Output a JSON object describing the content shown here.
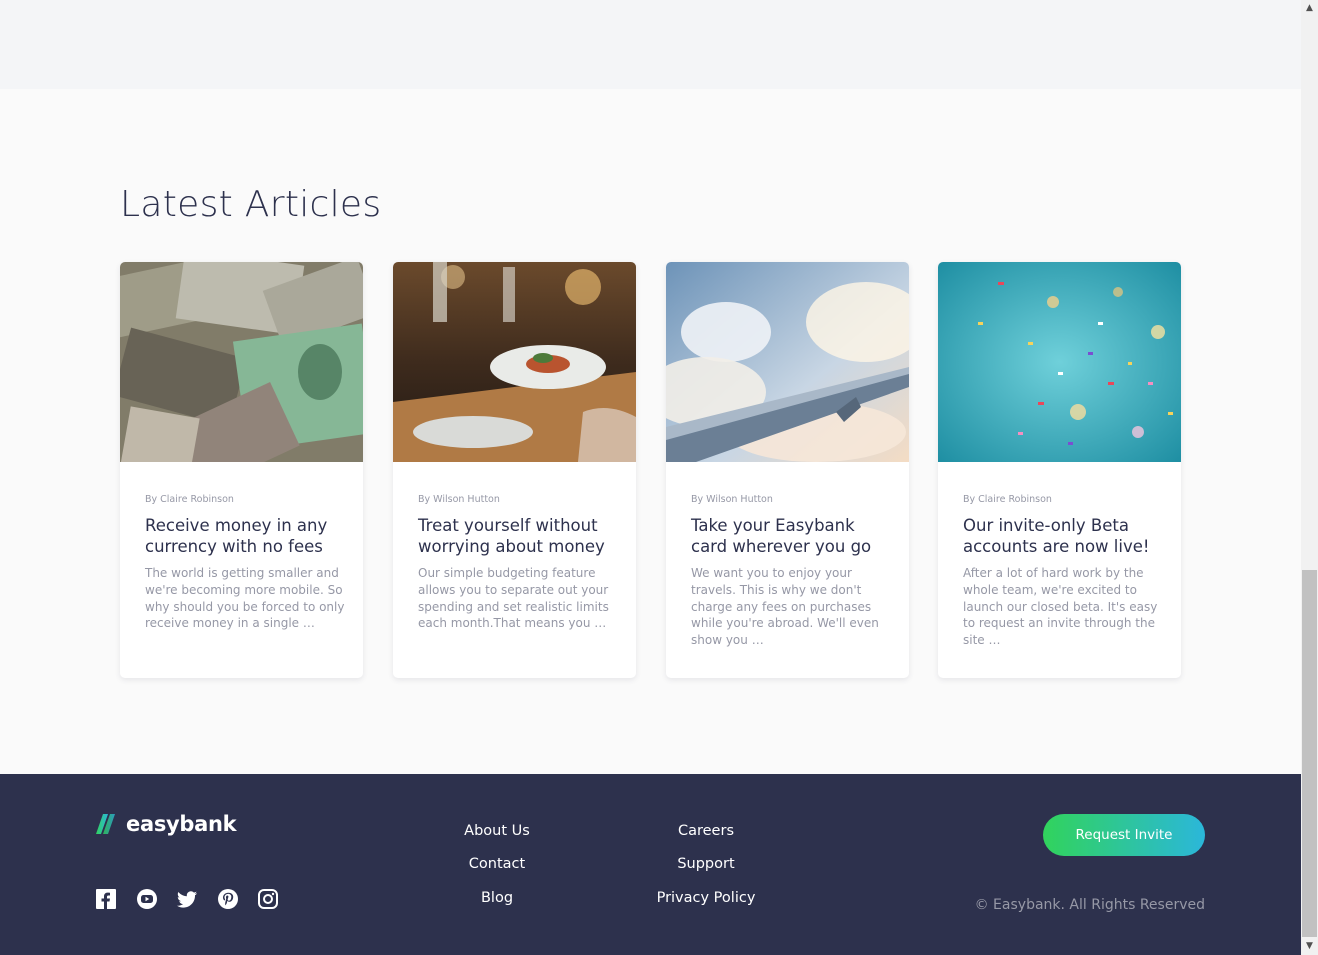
{
  "articles_section": {
    "title": "Latest Articles",
    "cards": [
      {
        "author": "By Claire Robinson",
        "title": "Receive money in any currency with no fees",
        "excerpt": "The world is getting smaller and we're becoming more mobile. So why should you be forced to only receive money in a single …"
      },
      {
        "author": "By Wilson Hutton",
        "title": "Treat yourself without worrying about money",
        "excerpt": "Our simple budgeting feature allows you to separate out your spending and set realistic limits each month.That means you …"
      },
      {
        "author": "By Wilson Hutton",
        "title": "Take your Easybank card wherever you go",
        "excerpt": "We want you to enjoy your travels. This is why we don't charge any fees on purchases while you're abroad. We'll even show you …"
      },
      {
        "author": "By Claire Robinson",
        "title": "Our invite-only Beta accounts are now live!",
        "excerpt": "After a lot of hard work by the whole team, we're excited to launch our closed beta. It's easy to request an invite through the site …"
      }
    ]
  },
  "footer": {
    "logo_text": "easybank",
    "links_col1": [
      "About Us",
      "Contact",
      "Blog"
    ],
    "links_col2": [
      "Careers",
      "Support",
      "Privacy Policy"
    ],
    "invite_label": "Request Invite",
    "copyright": "© Easybank. All Rights Reserved",
    "social_icons": [
      "facebook-icon",
      "youtube-icon",
      "twitter-icon",
      "pinterest-icon",
      "instagram-icon"
    ]
  },
  "colors": {
    "dark_blue": "#2d314d",
    "grayish_blue": "#9698a6",
    "lime_green": "#31d35c",
    "bright_cyan": "#2bb7da",
    "very_light_gray": "#fafafa"
  }
}
